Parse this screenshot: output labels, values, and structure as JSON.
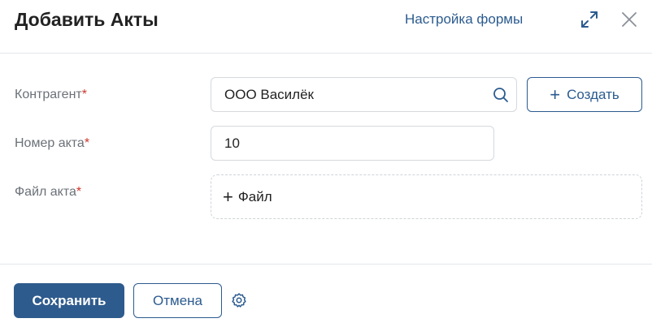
{
  "dialog": {
    "title": "Добавить Акты",
    "form_settings_label": "Настройка формы",
    "expand_icon": "expand-icon",
    "close_icon": "close-icon"
  },
  "fields": {
    "contractor": {
      "label": "Контрагент",
      "required_mark": "*",
      "value": "ООО Василёк"
    },
    "act_number": {
      "label": "Номер акта",
      "required_mark": "*",
      "value": "10"
    },
    "act_file": {
      "label": "Файл акта",
      "required_mark": "*",
      "add_label": "Файл"
    }
  },
  "create_button": {
    "plus": "+",
    "label": "Создать"
  },
  "footer": {
    "save_label": "Сохранить",
    "cancel_label": "Отмена",
    "settings_icon": "gear-icon"
  },
  "colors": {
    "accent": "#2b5b8f",
    "primary_button": "#2e5b8d",
    "required": "#d0342c",
    "label": "#6b7178"
  }
}
